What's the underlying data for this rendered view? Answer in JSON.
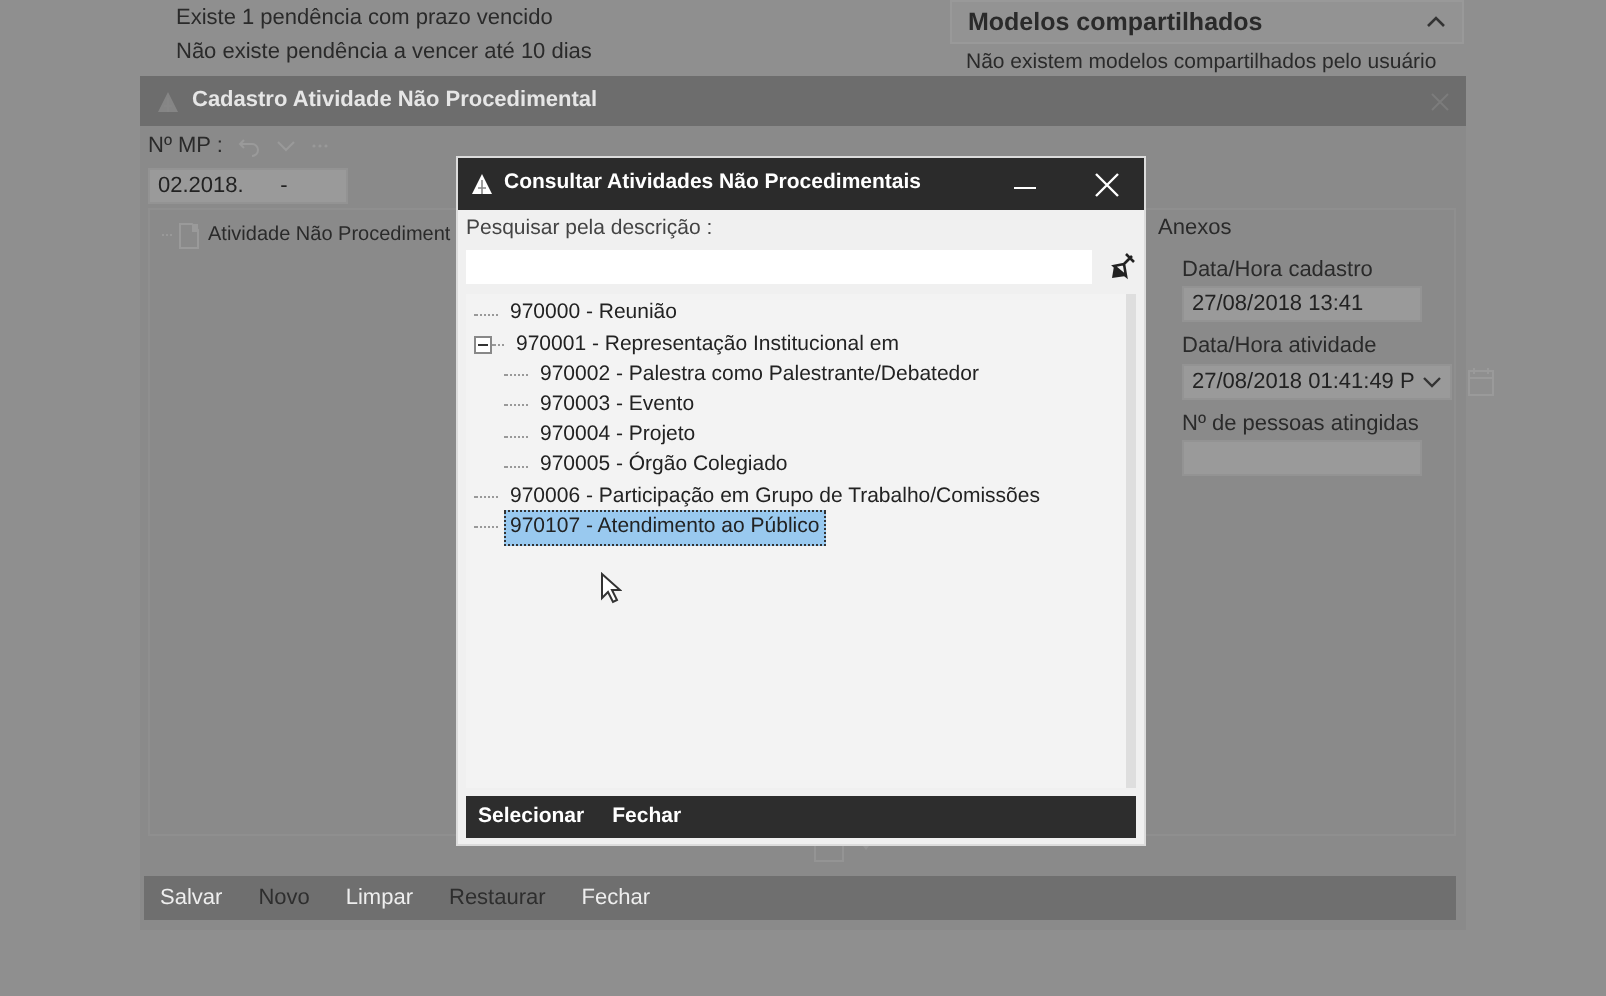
{
  "notices": [
    "Existe 1 pendência com prazo vencido",
    "Não existe pendência a vencer até 10 dias"
  ],
  "shared_models": {
    "title": "Modelos compartilhados",
    "expanded": true,
    "message": "Não existem modelos compartilhados pelo usuário"
  },
  "background_window": {
    "title": "Cadastro Atividade Não Procedimental",
    "mp_label": "Nº MP :",
    "mp_value": "02.2018.      -",
    "tree_item": "Atividade Não Procediment",
    "tab": "Anexos",
    "fields": [
      {
        "label": "Data/Hora cadastro",
        "value": "27/08/2018 13:41",
        "kind": "text"
      },
      {
        "label": "Data/Hora atividade",
        "value": "27/08/2018 01:41:49 P",
        "kind": "datetime"
      },
      {
        "label": "Nº de pessoas atingidas",
        "kind": "text"
      }
    ],
    "buttons": [
      {
        "label": "Salvar",
        "disabled": false
      },
      {
        "label": "Novo",
        "disabled": true
      },
      {
        "label": "Limpar",
        "disabled": false
      },
      {
        "label": "Restaurar",
        "disabled": true
      },
      {
        "label": "Fechar",
        "disabled": false
      }
    ]
  },
  "dialog": {
    "title": "Consultar Atividades Não Procedimentais",
    "search_label": "Pesquisar pela descrição :",
    "tree": [
      {
        "label": "970000 - Reunião",
        "selected": false
      },
      {
        "label": "970001 - Representação Institucional em",
        "selected": false,
        "expanded": true,
        "children": [
          {
            "label": "970002 - Palestra como Palestrante/Debatedor",
            "selected": false
          },
          {
            "label": "970003 - Evento",
            "selected": false
          },
          {
            "label": "970004 - Projeto",
            "selected": false
          },
          {
            "label": "970005 - Órgão Colegiado",
            "selected": false
          }
        ]
      },
      {
        "label": "970006 - Participação em Grupo de Trabalho/Comissões",
        "selected": false
      },
      {
        "label": "970107 - Atendimento ao Público",
        "selected": true
      }
    ],
    "buttons": [
      "Selecionar",
      "Fechar"
    ]
  }
}
